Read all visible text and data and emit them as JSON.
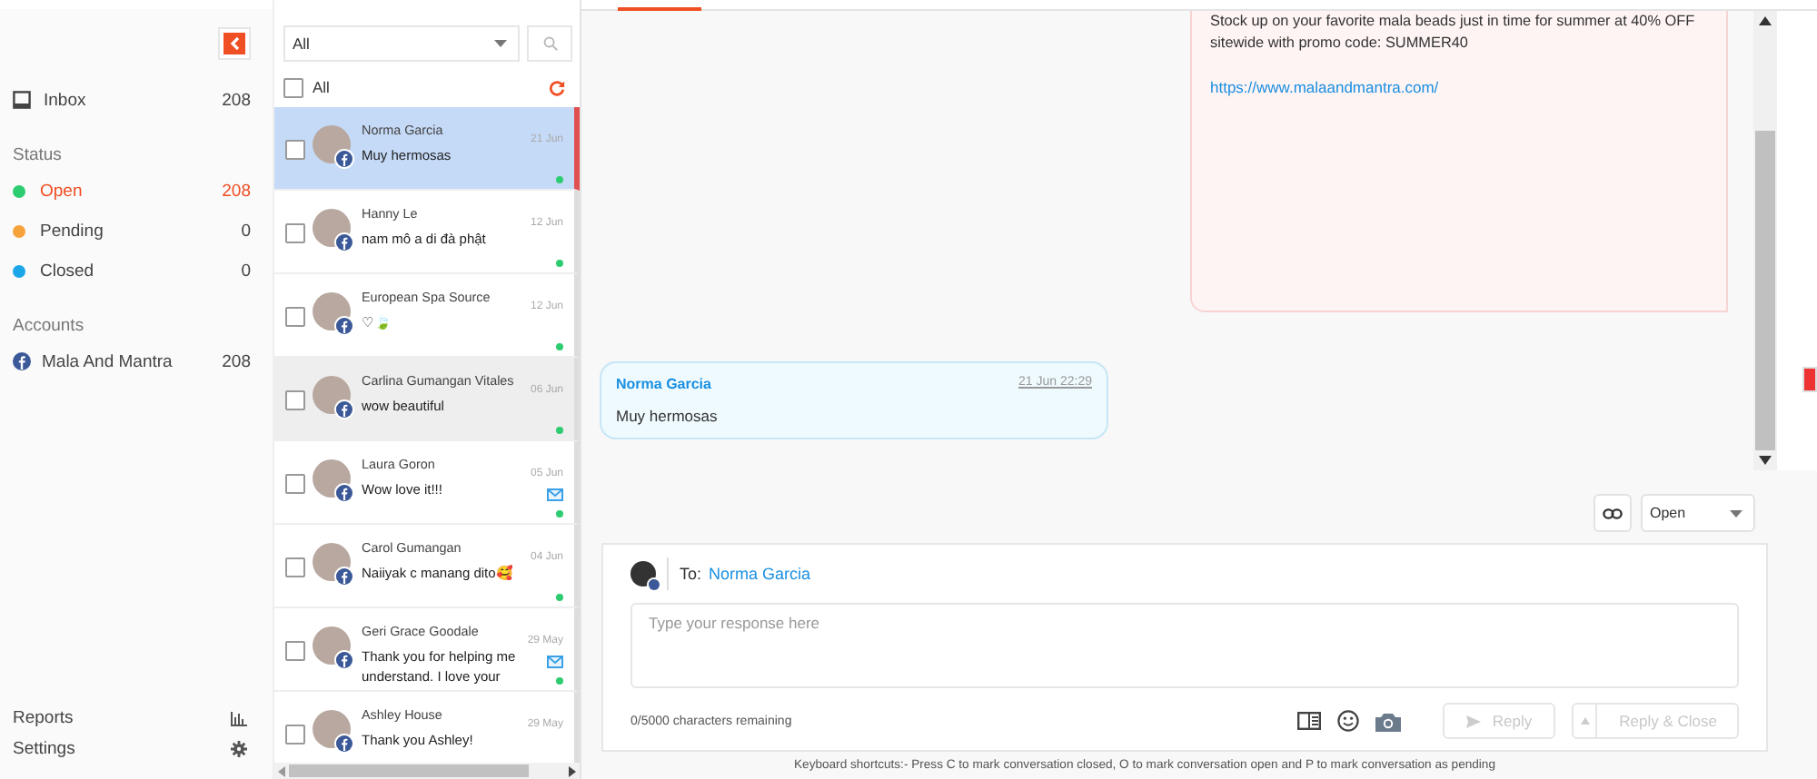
{
  "sidebar": {
    "inbox": {
      "label": "Inbox",
      "count": "208"
    },
    "status_heading": "Status",
    "statuses": [
      {
        "label": "Open",
        "count": "208",
        "color": "#2ecc71",
        "selected": true
      },
      {
        "label": "Pending",
        "count": "0",
        "color": "#f7a23b",
        "selected": false
      },
      {
        "label": "Closed",
        "count": "0",
        "color": "#1ba6e8",
        "selected": false
      }
    ],
    "accounts_heading": "Accounts",
    "accounts": [
      {
        "label": "Mala And Mantra",
        "count": "208"
      }
    ],
    "bottom": [
      {
        "label": "Reports",
        "kind": "reports"
      },
      {
        "label": "Settings",
        "kind": "settings"
      }
    ]
  },
  "list": {
    "filter": "All",
    "select_all": {
      "label": "All",
      "checked": false
    },
    "conversations": [
      {
        "name": "Norma Garcia",
        "preview": "Muy hermosas",
        "date": "21 Jun",
        "selected": true,
        "hovered": false,
        "checked": false,
        "unread_mail": false,
        "online": true
      },
      {
        "name": "Hanny Le",
        "preview": "nam mô a di đà phật",
        "date": "12 Jun",
        "selected": false,
        "hovered": false,
        "checked": false,
        "unread_mail": false,
        "online": true
      },
      {
        "name": "European Spa Source",
        "preview": "♡🍃",
        "date": "12 Jun",
        "selected": false,
        "hovered": false,
        "checked": false,
        "unread_mail": false,
        "online": true
      },
      {
        "name": "Carlina Gumangan Vitales",
        "preview": "wow beautiful",
        "date": "06 Jun",
        "selected": false,
        "hovered": true,
        "checked": false,
        "unread_mail": false,
        "online": true
      },
      {
        "name": "Laura Goron",
        "preview": "Wow love it!!!",
        "date": "05 Jun",
        "selected": false,
        "hovered": false,
        "checked": false,
        "unread_mail": true,
        "online": true
      },
      {
        "name": "Carol Gumangan",
        "preview": "Naiiyak c manang dito🥰",
        "date": "04 Jun",
        "selected": false,
        "hovered": false,
        "checked": false,
        "unread_mail": false,
        "online": true
      },
      {
        "name": "Geri Grace Goodale",
        "preview": "Thank you for helping me understand. I love your",
        "date": "29 May",
        "selected": false,
        "hovered": false,
        "checked": false,
        "unread_mail": true,
        "online": true
      },
      {
        "name": "Ashley House",
        "preview": "Thank you Ashley!",
        "date": "29 May",
        "selected": false,
        "hovered": false,
        "checked": false,
        "unread_mail": false,
        "online": false
      }
    ]
  },
  "messages": [
    {
      "kind": "outgoing",
      "text": "Stock up on your favorite mala beads just in time for summer at 40% OFF sitewide with promo code:  SUMMER40",
      "link": "https://www.malaandmantra.com/"
    },
    {
      "kind": "incoming",
      "sender": "Norma Garcia",
      "time": "21 Jun 22:29",
      "text": "Muy hermosas"
    }
  ],
  "status_select": "Open",
  "composer": {
    "to_label": "To:",
    "to_name": "Norma Garcia",
    "placeholder": "Type your response here",
    "counter": "0/5000 characters remaining",
    "reply": {
      "label": "Reply",
      "disabled": true
    },
    "reply_close": {
      "label": "Reply & Close",
      "disabled": true
    }
  },
  "footer": "Keyboard shortcuts:- Press C to mark conversation closed, O to mark conversation open and P to mark conversation as pending"
}
